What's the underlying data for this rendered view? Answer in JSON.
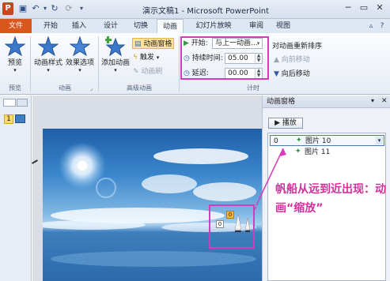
{
  "window": {
    "title": "演示文稿1 - Microsoft PowerPoint",
    "app_logo": "P"
  },
  "tabs": [
    "文件",
    "开始",
    "插入",
    "设计",
    "切换",
    "动画",
    "幻灯片放映",
    "审阅",
    "视图"
  ],
  "ribbon": {
    "preview": {
      "label": "预览",
      "group": "预览"
    },
    "animation": {
      "styles_label": "动画样式",
      "effects_label": "效果选项",
      "group": "动画"
    },
    "advanced": {
      "add_label": "添加动画",
      "pane_label": "动画窗格",
      "trigger_label": "触发",
      "painter_label": "动画刷",
      "group": "高级动画"
    },
    "timing": {
      "start_label": "开始:",
      "start_value": "与上一动画...",
      "duration_label": "持续时间:",
      "duration_value": "05.00",
      "delay_label": "延迟:",
      "delay_value": "00.00",
      "group": "计时",
      "reorder_label": "对动画重新排序",
      "move_earlier": "向前移动",
      "move_later": "向后移动"
    }
  },
  "left_panel": {
    "slide_number": "1"
  },
  "slide": {
    "tag_orange": "0",
    "tag_white": "0"
  },
  "anim_pane": {
    "title": "动画窗格",
    "play_label": "播放",
    "items": [
      {
        "index": "0",
        "name": "图片 10"
      },
      {
        "index": "",
        "name": "图片 11"
      }
    ]
  },
  "annotation": "帆船从远到近出现：动画“缩放”",
  "colors": {
    "accent_highlight": "#d43bbd",
    "file_tab": "#d9561d",
    "annotation_text": "#d6309e"
  }
}
